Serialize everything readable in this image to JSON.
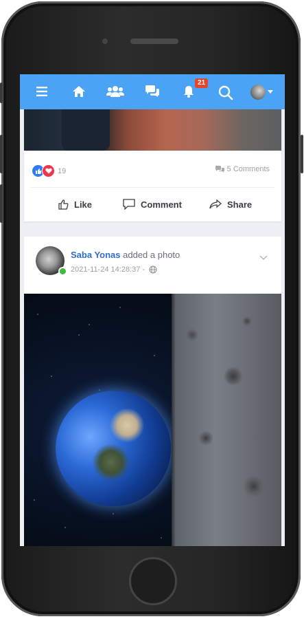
{
  "nav": {
    "notification_count": "21",
    "icons": [
      "menu-icon",
      "home-icon",
      "friends-icon",
      "messages-icon",
      "bell-icon",
      "search-icon",
      "avatar"
    ]
  },
  "prev_post": {
    "reaction_count": "19",
    "comments_label": "5 Comments",
    "actions": {
      "like": "Like",
      "comment": "Comment",
      "share": "Share"
    }
  },
  "post": {
    "author": "Saba Yonas",
    "action": "added a photo",
    "timestamp": "2021-11-24 14:28:37 -"
  },
  "colors": {
    "accent": "#4aa3f5",
    "like": "#2f7cf6",
    "love": "#f0344a",
    "author": "#2e6ec9",
    "online": "#3fb93f"
  }
}
